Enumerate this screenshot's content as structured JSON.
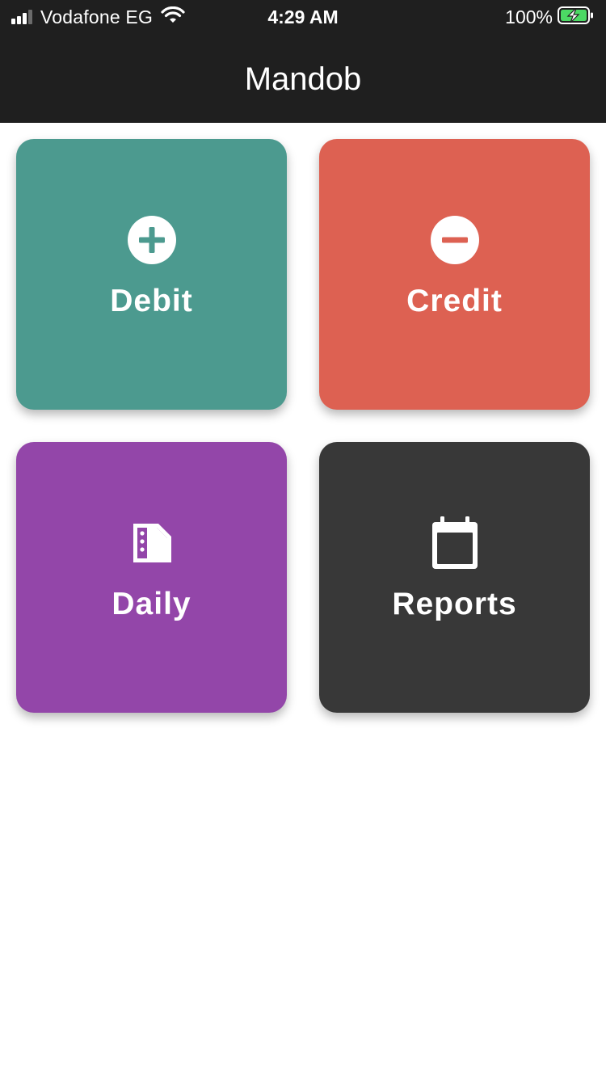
{
  "status_bar": {
    "carrier": "Vodafone EG",
    "time": "4:29 AM",
    "battery_percent": "100%",
    "signal_icon": "signal-bars-icon",
    "wifi_icon": "wifi-icon",
    "battery_icon": "battery-charging-icon"
  },
  "header": {
    "title": "Mandob",
    "background": "#1f1f1f"
  },
  "tiles": [
    {
      "label": "Debit",
      "icon": "plus-circle-icon",
      "color": "#4c9a8f"
    },
    {
      "label": "Credit",
      "icon": "minus-circle-icon",
      "color": "#dd6152"
    },
    {
      "label": "Daily",
      "icon": "document-icon",
      "color": "#9346a9"
    },
    {
      "label": "Reports",
      "icon": "calendar-icon",
      "color": "#383838"
    }
  ]
}
